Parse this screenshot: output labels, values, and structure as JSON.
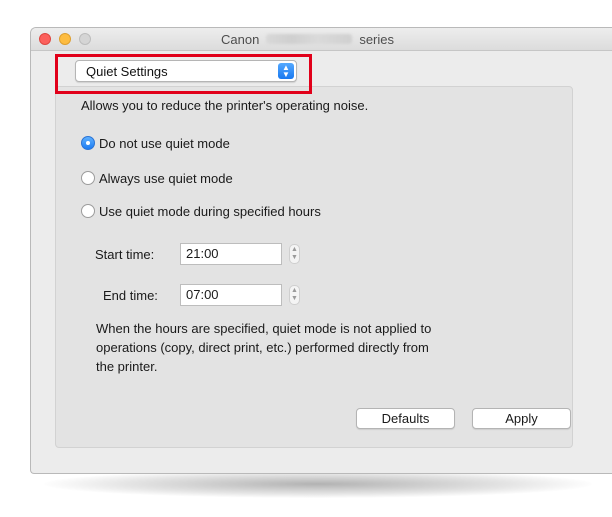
{
  "window": {
    "title_left": "Canon",
    "title_right": "series"
  },
  "settings_menu": {
    "selected": "Quiet Settings"
  },
  "description": "Allows you to reduce the printer's operating noise.",
  "options": [
    {
      "label": "Do not use quiet mode",
      "selected": true
    },
    {
      "label": "Always use quiet mode",
      "selected": false
    },
    {
      "label": "Use quiet mode during specified hours",
      "selected": false
    }
  ],
  "start_time": {
    "label": "Start time:",
    "value": "21:00"
  },
  "end_time": {
    "label": "End time:",
    "value": "07:00"
  },
  "note_lines": [
    "When the hours are specified, quiet mode is not applied to",
    "operations (copy, direct print, etc.) performed directly from",
    "the printer."
  ],
  "buttons": {
    "defaults": "Defaults",
    "apply": "Apply"
  },
  "colors": {
    "highlight_box": "#e1001a",
    "accent": "#1d7cf2"
  }
}
